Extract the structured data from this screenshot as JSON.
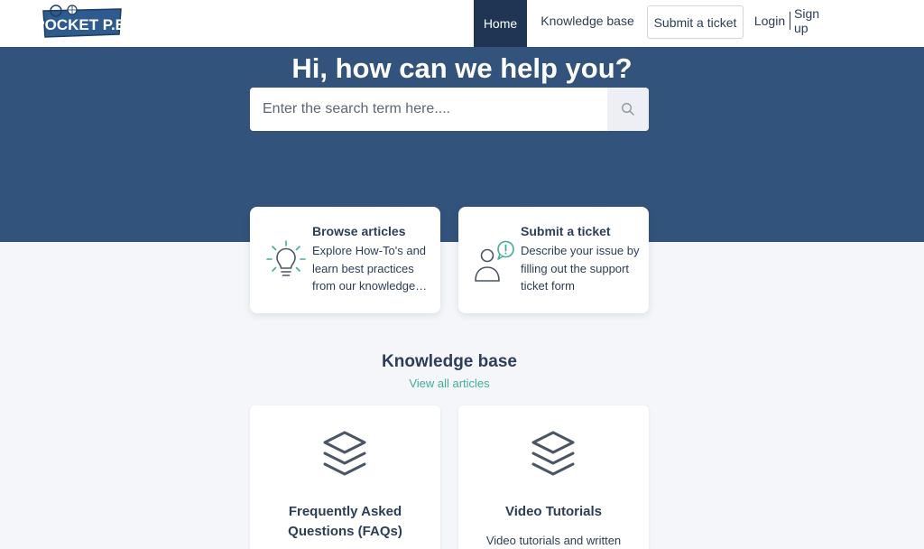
{
  "header": {
    "logo_text": "POCKET P.E.",
    "nav": {
      "home": "Home",
      "knowledge_base": "Knowledge base",
      "submit_ticket": "Submit a ticket",
      "login": "Login",
      "signup": "Sign up"
    }
  },
  "hero": {
    "title": "Hi, how can we help you?",
    "search_placeholder": "Enter the search term here...."
  },
  "cards": [
    {
      "title": "Browse articles",
      "description": "Explore How-To's and learn best practices from our knowledge…",
      "icon": "lightbulb-icon"
    },
    {
      "title": "Submit a ticket",
      "description": "Describe your issue by filling out the support ticket form",
      "icon": "person-alert-icon"
    }
  ],
  "knowledge_base": {
    "title": "Knowledge base",
    "view_all": "View all articles",
    "categories": [
      {
        "title": "Frequently Asked Questions (FAQs)",
        "description": "",
        "icon": "layers-icon"
      },
      {
        "title": "Video Tutorials",
        "description": "Video tutorials and written",
        "icon": "layers-icon"
      }
    ]
  },
  "colors": {
    "header_bg": "#ffffff",
    "nav_active_bg": "#1f3553",
    "hero_bg": "#31537c",
    "page_bg": "#f4f6f9",
    "accent_green": "#3fae99",
    "text_dark": "#2c3e57"
  }
}
